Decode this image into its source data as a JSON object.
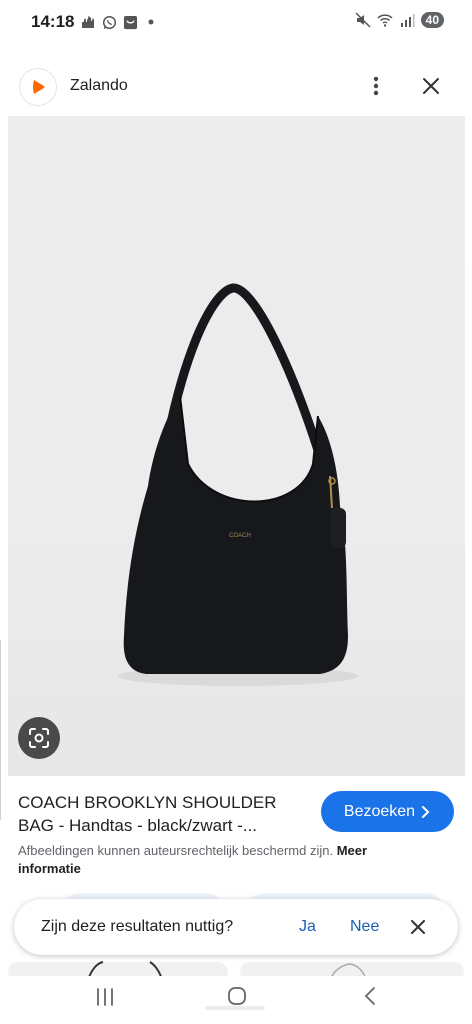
{
  "status_bar": {
    "time": "14:18",
    "battery": "40",
    "icons": [
      "mosque-icon",
      "whatsapp-icon",
      "shop-icon",
      "dot-icon",
      "mute-icon",
      "wifi-icon",
      "signal-icon"
    ]
  },
  "header": {
    "title": "Zalando",
    "logo_color": "#ff6900"
  },
  "product": {
    "title": "COACH BROOKLYN SHOULDER BAG - Handtas - black/zwart -...",
    "visit_label": "Bezoeken",
    "copyright_text": "Afbeeldingen kunnen auteursrechtelijk beschermd zijn.",
    "more_info_label": "Meer informatie",
    "brand_mark": "COACH"
  },
  "feedback": {
    "question": "Zijn deze resultaten nuttig?",
    "yes_label": "Ja",
    "no_label": "Nee"
  },
  "colors": {
    "accent": "#1a73e8",
    "link": "#1a5fb4",
    "bag": "#16181b",
    "background": "#ececec"
  }
}
